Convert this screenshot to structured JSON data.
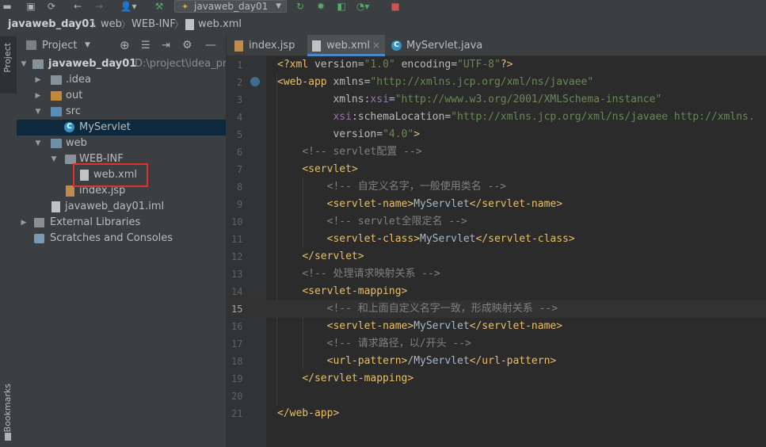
{
  "toolbar": {
    "run_config": "javaweb_day01"
  },
  "breadcrumb": [
    "javaweb_day01",
    "web",
    "WEB-INF",
    "web.xml"
  ],
  "sidebar": {
    "project_label": "Project",
    "bookmarks_label": "Bookmarks"
  },
  "project_panel": {
    "title": "Project",
    "tree": [
      {
        "label": "javaweb_day01",
        "extra": "D:\\project\\idea_pro",
        "depth": 0,
        "expanded": true,
        "icon": "module-folder-icon"
      },
      {
        "label": ".idea",
        "depth": 1,
        "expanded": false,
        "icon": "folder-icon"
      },
      {
        "label": "out",
        "depth": 1,
        "expanded": false,
        "icon": "folder-orange-icon"
      },
      {
        "label": "src",
        "depth": 1,
        "expanded": true,
        "icon": "folder-source-icon"
      },
      {
        "label": "MyServlet",
        "depth": 2,
        "icon": "java-class-icon",
        "selected": true
      },
      {
        "label": "web",
        "depth": 1,
        "expanded": true,
        "icon": "folder-web-icon"
      },
      {
        "label": "WEB-INF",
        "depth": 2,
        "expanded": true,
        "icon": "folder-icon"
      },
      {
        "label": "web.xml",
        "depth": 3,
        "icon": "xml-file-icon",
        "highlighted": true
      },
      {
        "label": "index.jsp",
        "depth": 2,
        "icon": "jsp-file-icon"
      },
      {
        "label": "javaweb_day01.iml",
        "depth": 1,
        "icon": "iml-file-icon"
      },
      {
        "label": "External Libraries",
        "depth": 0,
        "expanded": false,
        "icon": "libraries-icon"
      },
      {
        "label": "Scratches and Consoles",
        "depth": 0,
        "icon": "scratches-icon"
      }
    ]
  },
  "editor": {
    "tabs": [
      {
        "label": "index.jsp",
        "icon": "jsp-file-icon",
        "active": false
      },
      {
        "label": "web.xml",
        "icon": "xml-file-icon",
        "active": true
      },
      {
        "label": "MyServlet.java",
        "icon": "java-class-icon",
        "active": false
      }
    ],
    "current_line": 15,
    "lines": [
      "<?xml version=\"1.0\" encoding=\"UTF-8\"?>",
      "<web-app xmlns=\"http://xmlns.jcp.org/xml/ns/javaee\"",
      "         xmlns:xsi=\"http://www.w3.org/2001/XMLSchema-instance\"",
      "         xsi:schemaLocation=\"http://xmlns.jcp.org/xml/ns/javaee http://xmlns.",
      "         version=\"4.0\">",
      "    <!-- servlet配置 -->",
      "    <servlet>",
      "        <!-- 自定义名字，一般使用类名 -->",
      "        <servlet-name>MyServlet</servlet-name>",
      "        <!-- servlet全限定名 -->",
      "        <servlet-class>MyServlet</servlet-class>",
      "    </servlet>",
      "    <!-- 处理请求映射关系 -->",
      "    <servlet-mapping>",
      "        <!-- 和上面自定义名字一致，形成映射关系 -->",
      "        <servlet-name>MyServlet</servlet-name>",
      "        <!-- 请求路径，以/开头 -->",
      "        <url-pattern>/MyServlet</url-pattern>",
      "    </servlet-mapping>",
      "",
      "</web-app>"
    ]
  },
  "colors": {
    "highlight_box": "#e03030",
    "tag": "#e8bf6a",
    "string": "#6a8759",
    "comment": "#808080",
    "namespace": "#9876aa",
    "selection": "#0d293e",
    "active_tab_underline": "#4a88c7"
  }
}
